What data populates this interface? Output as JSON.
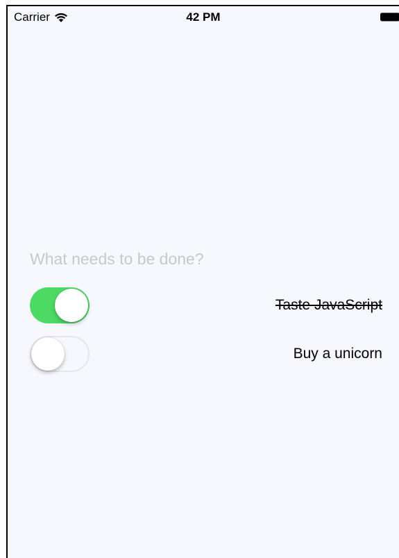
{
  "status_bar": {
    "carrier": "Carrier",
    "time": "42 PM",
    "icons": [
      "wifi-icon",
      "battery-icon"
    ]
  },
  "new_todo": {
    "placeholder": "What needs to be done?",
    "value": ""
  },
  "todos": [
    {
      "text": "Taste JavaScript",
      "completed": true
    },
    {
      "text": "Buy a unicorn",
      "completed": false
    }
  ],
  "colors": {
    "background": "#f7f8fd",
    "toggle_on": "#4cd964",
    "toggle_off_border": "#e5e5ea",
    "placeholder": "#c7c7cd"
  }
}
